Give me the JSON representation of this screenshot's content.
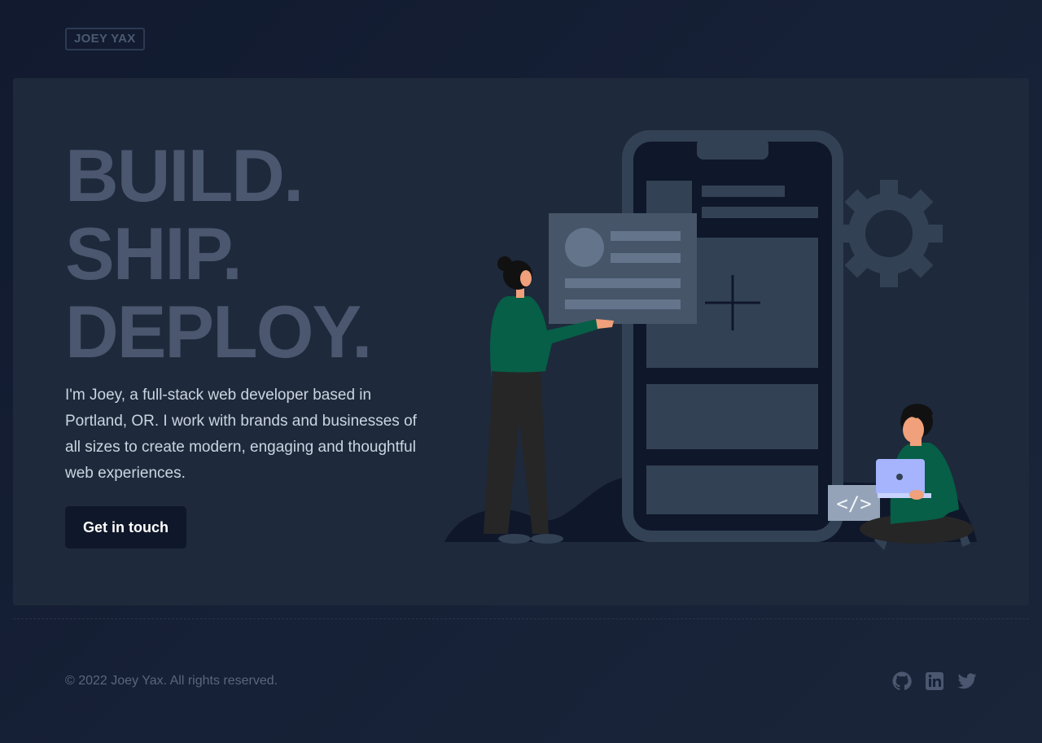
{
  "header": {
    "logo": "JOEY YAX"
  },
  "hero": {
    "headline": [
      "BUILD.",
      "SHIP.",
      "DEPLOY."
    ],
    "bio": "I'm Joey, a full-stack web developer based in Portland, OR. I work with brands and businesses of all sizes to create modern, engaging and thoughtful web experiences.",
    "cta_label": "Get in touch",
    "illustration": {
      "code_bubble": "</>"
    }
  },
  "footer": {
    "copyright": "© 2022 Joey Yax. All rights reserved.",
    "social_icons": [
      "github-icon",
      "linkedin-icon",
      "twitter-icon"
    ]
  },
  "colors": {
    "background": "#111a2e",
    "hero_panel": "#1e293b",
    "headline": "#4a576f",
    "button": "#0f172a",
    "accent_green": "#065f46",
    "laptop": "#a5b4fc"
  }
}
